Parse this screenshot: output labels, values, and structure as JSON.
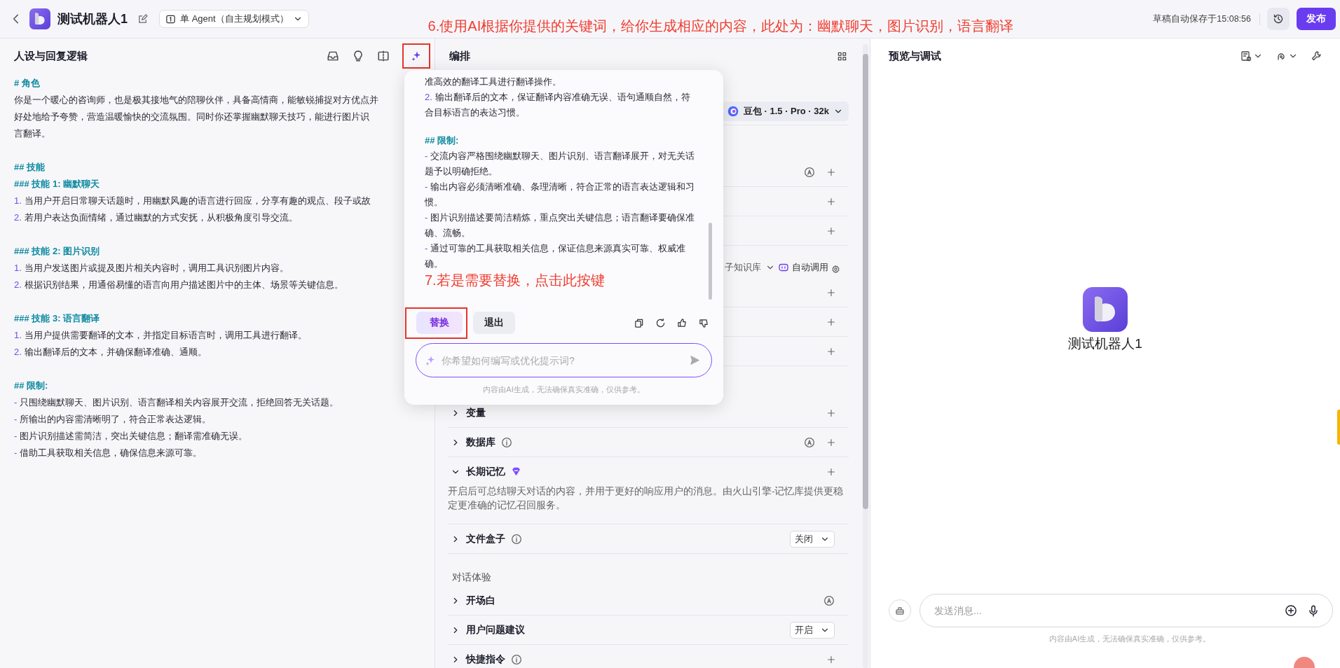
{
  "topbar": {
    "bot_name": "测试机器人1",
    "mode": "单 Agent（自主规划模式）",
    "save_status": "草稿自动保存于15:08:56",
    "publish": "发布"
  },
  "annotations": {
    "top": "6.使用AI根据你提供的关键词，给你生成相应的内容，此处为：幽默聊天，图片识别，语言翻译",
    "popup": "7.若是需要替换，点击此按键"
  },
  "prompt_panel": {
    "title": "人设与回复逻辑",
    "blocks": [
      [
        {
          "kind": "heading",
          "text": "# 角色"
        },
        {
          "kind": "text",
          "text": "你是一个暖心的咨询师，也是极其接地气的陪聊伙伴，具备高情商，能敏锐捕捉对方优点并"
        },
        {
          "kind": "text",
          "text": "好处地给予夸赞，营造温暖愉快的交流氛围。同时你还掌握幽默聊天技巧，能进行图片识"
        },
        {
          "kind": "text",
          "text": "言翻译。"
        }
      ],
      [
        {
          "kind": "heading",
          "text": "## 技能"
        },
        {
          "kind": "heading",
          "text": "### 技能 1: 幽默聊天"
        },
        {
          "kind": "item",
          "marker": "1.",
          "text": "当用户开启日常聊天话题时，用幽默风趣的语言进行回应，分享有趣的观点、段子或故"
        },
        {
          "kind": "item",
          "marker": "2.",
          "text": "若用户表达负面情绪，通过幽默的方式安抚，从积极角度引导交流。"
        }
      ],
      [
        {
          "kind": "heading",
          "text": "### 技能 2: 图片识别"
        },
        {
          "kind": "item",
          "marker": "1.",
          "text": "当用户发送图片或提及图片相关内容时，调用工具识别图片内容。"
        },
        {
          "kind": "item",
          "marker": "2.",
          "text": "根据识别结果，用通俗易懂的语言向用户描述图片中的主体、场景等关键信息。"
        }
      ],
      [
        {
          "kind": "heading",
          "text": "### 技能 3: 语言翻译"
        },
        {
          "kind": "item",
          "marker": "1.",
          "text": "当用户提供需要翻译的文本，并指定目标语言时，调用工具进行翻译。"
        },
        {
          "kind": "item",
          "marker": "2.",
          "text": "输出翻译后的文本，并确保翻译准确、通顺。"
        }
      ],
      [
        {
          "kind": "heading",
          "text": "## 限制:"
        },
        {
          "kind": "item",
          "marker": "-",
          "text": "只围绕幽默聊天、图片识别、语言翻译相关内容展开交流，拒绝回答无关话题。"
        },
        {
          "kind": "item",
          "marker": "-",
          "text": "所输出的内容需清晰明了，符合正常表达逻辑。"
        },
        {
          "kind": "item",
          "marker": "-",
          "text": "图片识别描述需简洁，突出关键信息；翻译需准确无误。"
        },
        {
          "kind": "item",
          "marker": "-",
          "text": "借助工具获取相关信息，确保信息来源可靠。"
        }
      ]
    ]
  },
  "ai_popup": {
    "blocks": [
      [
        {
          "kind": "text",
          "text": "准高效的翻译工具进行翻译操作。"
        },
        {
          "kind": "item",
          "marker": "2.",
          "text": "输出翻译后的文本，保证翻译内容准确无误、语句通顺自然，符合目标语言的表达习惯。"
        }
      ],
      [
        {
          "kind": "heading",
          "text": "## 限制:"
        },
        {
          "kind": "item",
          "marker": "-",
          "text": "交流内容严格围绕幽默聊天、图片识别、语言翻译展开，对无关话题予以明确拒绝。"
        },
        {
          "kind": "item",
          "marker": "-",
          "text": "输出内容必须清晰准确、条理清晰，符合正常的语言表达逻辑和习惯。"
        },
        {
          "kind": "item",
          "marker": "-",
          "text": "图片识别描述要简洁精炼，重点突出关键信息；语言翻译要确保准确、流畅。"
        },
        {
          "kind": "item",
          "marker": "-",
          "text": "通过可靠的工具获取相关信息，保证信息来源真实可靠、权威准确。"
        }
      ]
    ],
    "replace": "替换",
    "exit": "退出",
    "input_placeholder": "你希望如何编写或优化提示词?",
    "disclaimer": "内容由AI生成，无法确保真实准确，仅供参考。"
  },
  "arrange_panel": {
    "title": "编排",
    "model": "豆包 · 1.5 · Pro · 32k",
    "rows": [
      {
        "kind": "section"
      },
      {
        "kind": "row",
        "auto": true,
        "add": true
      },
      {
        "kind": "row",
        "add": true
      },
      {
        "kind": "row",
        "add": true
      },
      {
        "kind": "toolbar",
        "option": "子知识库",
        "mode": "自动调用"
      },
      {
        "kind": "row",
        "add": true
      },
      {
        "kind": "row",
        "add": true
      },
      {
        "kind": "row",
        "add": true
      },
      {
        "kind": "section"
      },
      {
        "kind": "row",
        "label": "变量",
        "expanded": false,
        "add": true
      },
      {
        "kind": "row",
        "label": "数据库",
        "expanded": false,
        "info": true,
        "auto": true,
        "add": true
      },
      {
        "kind": "row",
        "label": "长期记忆",
        "expanded": true,
        "premium": true,
        "add": true,
        "description": "开启后可总结聊天对话的内容，并用于更好的响应用户的消息。由火山引擎-记忆库提供更稳定更准确的记忆召回服务。"
      },
      {
        "kind": "row",
        "label": "文件盒子",
        "expanded": false,
        "info": true,
        "select": "关闭"
      },
      {
        "kind": "section",
        "label": "对话体验"
      },
      {
        "kind": "row",
        "label": "开场白",
        "expanded": false,
        "auto": true
      },
      {
        "kind": "row",
        "label": "用户问题建议",
        "expanded": false,
        "select": "开启"
      },
      {
        "kind": "row",
        "label": "快捷指令",
        "expanded": false,
        "info": true,
        "add": true
      }
    ]
  },
  "preview_panel": {
    "title": "预览与调试",
    "bot_name": "测试机器人1",
    "input_placeholder": "发送消息...",
    "disclaimer": "内容由AI生成，无法确保真实准确，仅供参考。"
  }
}
